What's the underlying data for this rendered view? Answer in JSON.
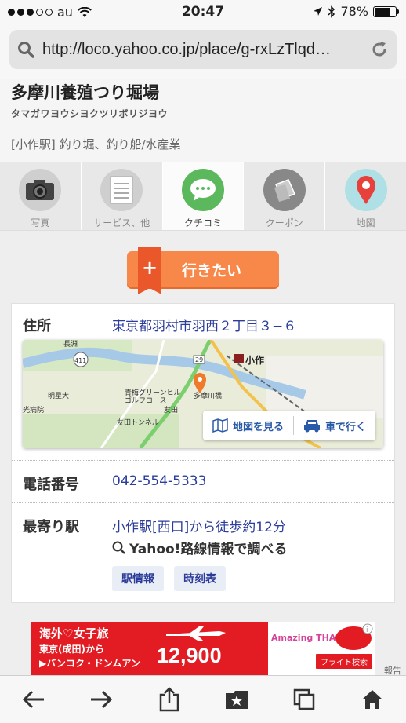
{
  "status": {
    "carrier": "au",
    "time": "20:47",
    "battery": "78%",
    "battery_level": 0.78
  },
  "browser": {
    "url": "http://loco.yahoo.co.jp/place/g-rxLzTlqd…"
  },
  "place": {
    "name": "多摩川養殖つり堀場",
    "kana": "タマガワヨウシヨクツリボリジヨウ",
    "category": "[小作駅] 釣り堀、釣り船/水産業"
  },
  "tabs": [
    {
      "label": "写真",
      "icon": "camera-icon",
      "color": "#888888"
    },
    {
      "label": "サービス、他",
      "icon": "document-icon",
      "color": "#aaaaaa"
    },
    {
      "label": "クチコミ",
      "icon": "speech-bubble-icon",
      "color": "#5cb85c"
    },
    {
      "label": "クーポン",
      "icon": "coupon-icon",
      "color": "#888888"
    },
    {
      "label": "地図",
      "icon": "map-pin-icon",
      "color": "#e8413b"
    }
  ],
  "want_button": {
    "label": "行きたい"
  },
  "info": {
    "address_label": "住所",
    "address": "東京都羽村市羽西２丁目３−６",
    "map": {
      "view_map": "地図を見る",
      "by_car": "車で行く",
      "labels": [
        "小作",
        "明星大",
        "青梅グリーンヒル",
        "ゴルフコース",
        "多摩川橋",
        "友田",
        "友田トンネル",
        "光病院",
        "長淵",
        "411",
        "29"
      ]
    },
    "phone_label": "電話番号",
    "phone": "042-554-5333",
    "station_label": "最寄り駅",
    "station": "小作駅[西口]から徒歩約12分",
    "route_search": "Yahoo!路線情報で調べる",
    "chips": [
      "駅情報",
      "時刻表"
    ]
  },
  "ad": {
    "line1": "海外♡女子旅",
    "line2": "東京(成田)から",
    "line3": "▶バンコク・ドンムアン",
    "price": "12,900",
    "thai": "Amazing THAILAND",
    "flight": "フライト検索",
    "side": "報告"
  },
  "toolbar": [
    "back-icon",
    "forward-icon",
    "share-icon",
    "bookmarks-icon",
    "tabs-icon",
    "home-icon"
  ]
}
